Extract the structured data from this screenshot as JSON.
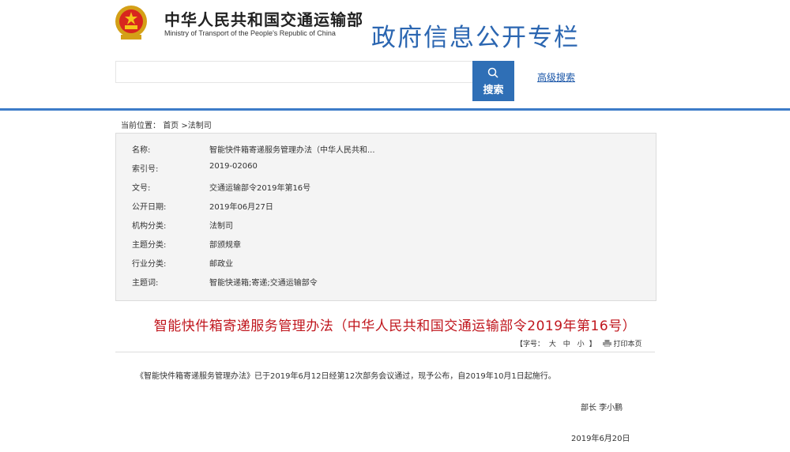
{
  "header": {
    "cn_name": "中华人民共和国交通运输部",
    "en_name": "Ministry of Transport of the People's Republic of China",
    "column_title": "政府信息公开专栏"
  },
  "search": {
    "placeholder": "",
    "button_label": "搜索",
    "advanced_label": "高级搜索"
  },
  "breadcrumb": {
    "prefix": "当前位置：",
    "home": "首页",
    "separator": ">",
    "current": "法制司"
  },
  "info": [
    {
      "key": "名称:",
      "value": "智能快件箱寄递服务管理办法（中华人民共和..."
    },
    {
      "key": "索引号:",
      "value": "2019-02060"
    },
    {
      "key": "文号:",
      "value": "交通运输部令2019年第16号"
    },
    {
      "key": "公开日期:",
      "value": "2019年06月27日"
    },
    {
      "key": "机构分类:",
      "value": "法制司"
    },
    {
      "key": "主题分类:",
      "value": "部颁规章"
    },
    {
      "key": "行业分类:",
      "value": "邮政业"
    },
    {
      "key": "主题词:",
      "value": "智能快递箱;寄递;交通运输部令"
    }
  ],
  "article": {
    "title": "智能快件箱寄递服务管理办法（中华人民共和国交通运输部令2019年第16号）",
    "font_prefix": "【字号：",
    "size_large": "大",
    "size_medium": "中",
    "size_small": "小",
    "font_suffix": "】",
    "print_label": "打印本页",
    "body": "《智能快件箱寄递服务管理办法》已于2019年6月12日经第12次部务会议通过，现予公布，自2019年10月1日起施行。",
    "signer": "部长  李小鹏",
    "date": "2019年6月20日"
  },
  "colors": {
    "brand_blue": "#2f6fb6",
    "title_red": "#c0161d",
    "header_line": "#3d7cc8"
  }
}
